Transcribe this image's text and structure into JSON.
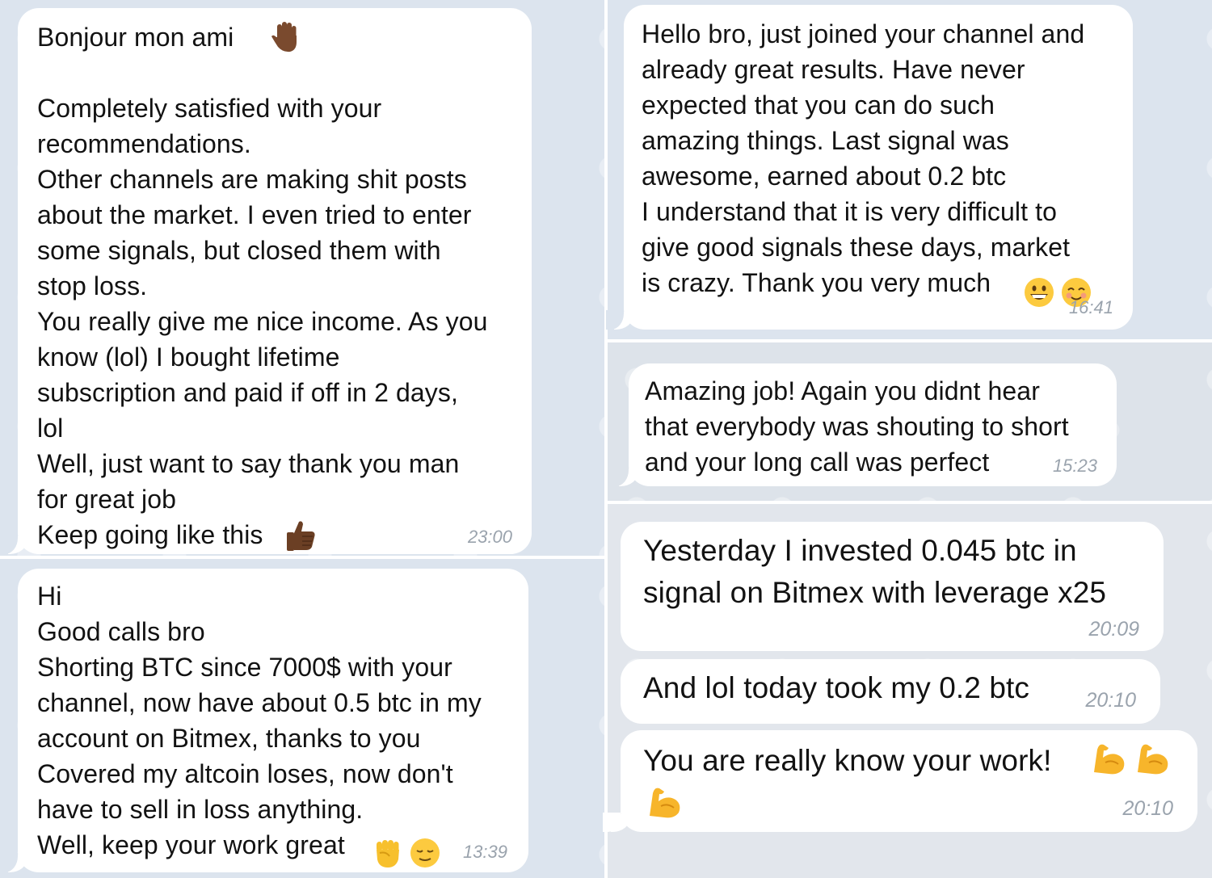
{
  "messages": {
    "m1": {
      "text": "Bonjour mon ami\n\nCompletely satisfied with your\nrecommendations.\nOther channels are making shit posts\nabout the market. I even tried to enter\nsome signals, but closed them with\nstop loss.\nYou really give me nice income. As you\nknow (lol) I bought lifetime\nsubscription and paid if off in 2 days,\nlol\nWell, just want to say thank you man\nfor great job\nKeep going like this",
      "time": "23:00"
    },
    "m2": {
      "text": "Hi\nGood calls bro\nShorting BTC since 7000$ with your\nchannel, now have about 0.5 btc in my\naccount on Bitmex, thanks to you\nCovered my altcoin loses, now don't\nhave to sell in loss anything.\nWell, keep your work great",
      "time": "13:39"
    },
    "m3": {
      "text": "Hello bro, just joined your channel and\nalready great results. Have never\nexpected that you can do such\namazing things. Last signal was\nawesome, earned about 0.2 btc\nI understand that it is very difficult to\ngive good signals these days, market\nis crazy. Thank you very much",
      "time": "16:41"
    },
    "m4": {
      "text": "Amazing job! Again you didnt hear\nthat everybody was shouting to short\nand your long call was perfect",
      "time": "15:23"
    },
    "m5": {
      "text": "Yesterday I invested 0.045 btc in\nsignal on Bitmex with leverage x25",
      "time": "20:09"
    },
    "m6": {
      "text": "And lol today took my 0.2 btc",
      "time": "20:10"
    },
    "m7": {
      "text": "You are really know your work!",
      "time": "20:10"
    }
  },
  "icons": [
    "raised-hand-icon",
    "thumbs-up-icon",
    "raised-fist-icon",
    "relieved-face-icon",
    "grinning-face-icon",
    "smiling-face-icon",
    "flexed-biceps-icon"
  ],
  "colors": {
    "bubble": "#ffffff",
    "background": "#dce4ee",
    "time": "#9aa3ad",
    "text": "#121212"
  }
}
